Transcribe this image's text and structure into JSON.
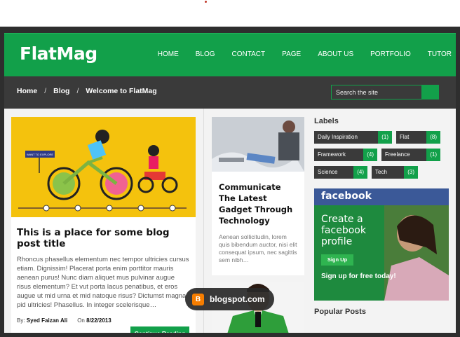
{
  "app": {
    "logo": "FlatMag",
    "nav": [
      "HOME",
      "BLOG",
      "CONTACT",
      "PAGE",
      "ABOUT US",
      "PORTFOLIO",
      "TUTOR"
    ]
  },
  "breadcrumb": {
    "items": [
      "Home",
      "Blog",
      "Welcome to FlatMag"
    ],
    "separator": "/"
  },
  "search": {
    "placeholder": "Search the site"
  },
  "main_post": {
    "title": "This is a place for some blog post title",
    "excerpt": "Rhoncus phasellus elementum nec tempor ultricies cursus etiam. Dignissim! Placerat porta enim porttitor mauris aenean purus! Nunc diam aliquet mus pulvinar augue risus elementum? Et vut porta lacus penatibus, et eros augue ut mid urna et mid natoque risus? Dictumst magna pid ultricies! Phasellus. In integer scelerisque…",
    "by_label": "By:",
    "author": "Syed Faizan Ali",
    "on_label": "On",
    "date": "8/22/2013",
    "continue_label": "Continue Reading",
    "illustration_sign": "WANT TO EXPLORE"
  },
  "side_post": {
    "title": "Communicate The Latest Gadget Through Technology",
    "excerpt": "Aenean sollicitudin, lorem quis bibendum auctor, nisi elit consequat ipsum, nec sagittis sem nibh…"
  },
  "labels": {
    "title": "Labels",
    "items": [
      {
        "name": "Daily Inspiration",
        "count": "(1)"
      },
      {
        "name": "Flat",
        "count": "(8)"
      },
      {
        "name": "Framework",
        "count": "(4)"
      },
      {
        "name": "Freelance",
        "count": "(1)"
      },
      {
        "name": "Science",
        "count": "(4)"
      },
      {
        "name": "Tech",
        "count": "(3)"
      }
    ]
  },
  "facebook": {
    "brand": "facebook",
    "heading": "Create a facebook profile",
    "signup": "Sign Up",
    "free": "Sign up for free today!"
  },
  "popular_posts": {
    "title": "Popular Posts"
  },
  "badge": {
    "text": "blogspot.com",
    "icon": "blogger-icon"
  },
  "colors": {
    "accent": "#12a04a",
    "dark": "#3a3a3a",
    "facebook": "#3b5998"
  }
}
